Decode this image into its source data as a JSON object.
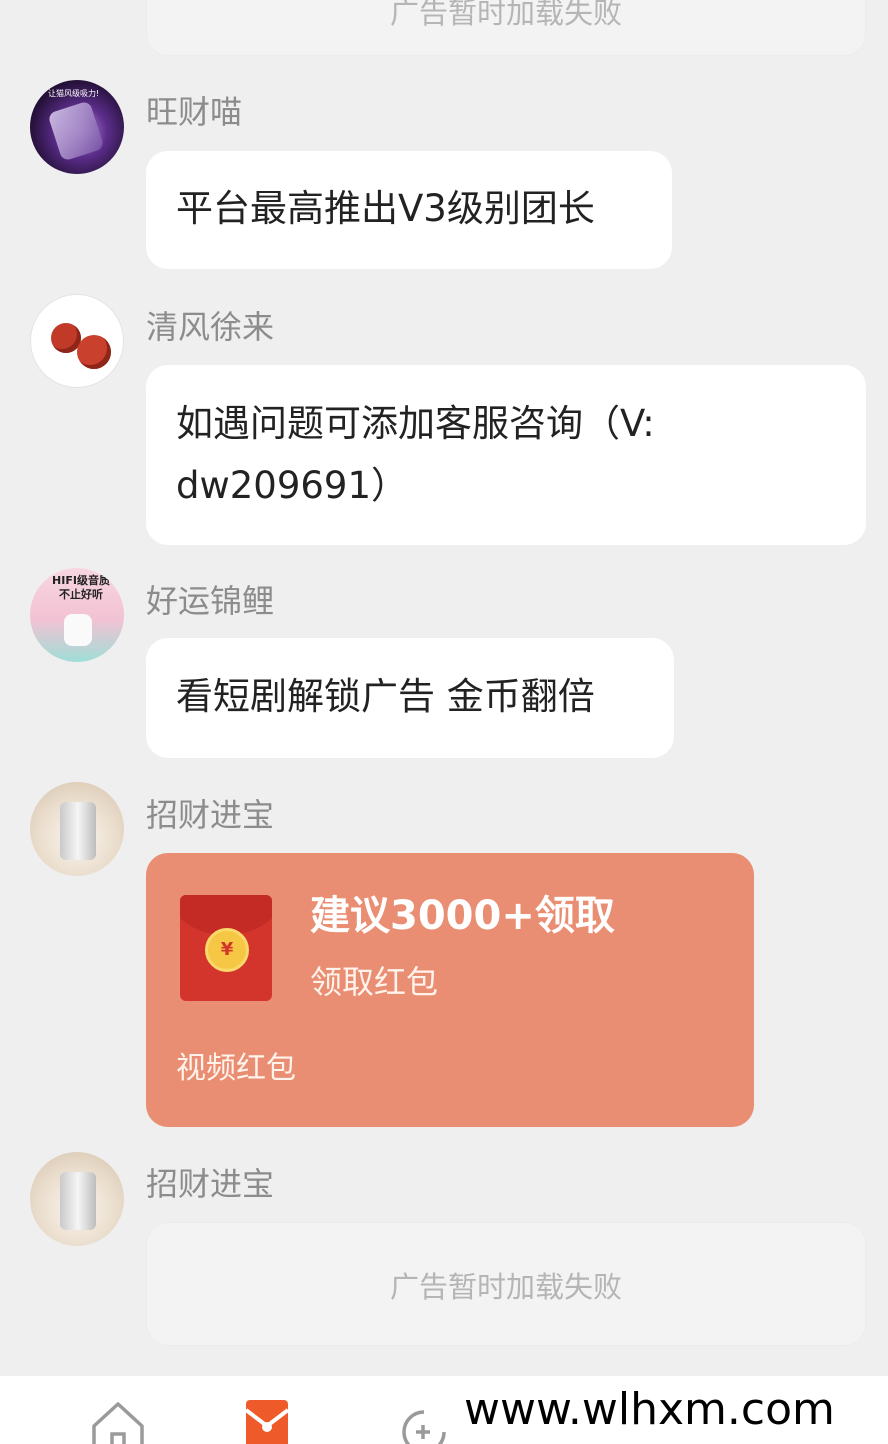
{
  "top_fail_text": "广告暂时加载失败",
  "messages": [
    {
      "sender": "旺财喵",
      "text": "平台最高推出V3级别团长"
    },
    {
      "sender": "清风徐来",
      "text_line1": "如遇问题可添加客服咨询（V:",
      "text_line2": "dw209691）"
    },
    {
      "sender": "好运锦鲤",
      "text": "看短剧解锁广告 金币翻倍"
    },
    {
      "sender": "招财进宝",
      "red_packet": {
        "title": "建议3000+领取",
        "subtitle": "领取红包",
        "footer": "视频红包",
        "coin_symbol": "¥"
      }
    },
    {
      "sender": "招财进宝",
      "ad_text": "广告暂时加载失败"
    }
  ],
  "avatar_texts": {
    "wangcai": "让猫风级吸力!",
    "haoyun_line1": "HIFI级音质",
    "haoyun_line2": "不止好听"
  },
  "tabbar": {
    "icons": [
      "home-icon",
      "red-envelope-icon",
      "game-add-icon"
    ]
  },
  "watermark": "www.wlhxm.com",
  "colors": {
    "background": "#efefef",
    "bubble": "#ffffff",
    "red_packet": "#e98e72",
    "envelope": "#d3352c",
    "coin": "#f6c745",
    "sender_name": "#8c8c8c",
    "tab_active": "#ef5a2a"
  }
}
